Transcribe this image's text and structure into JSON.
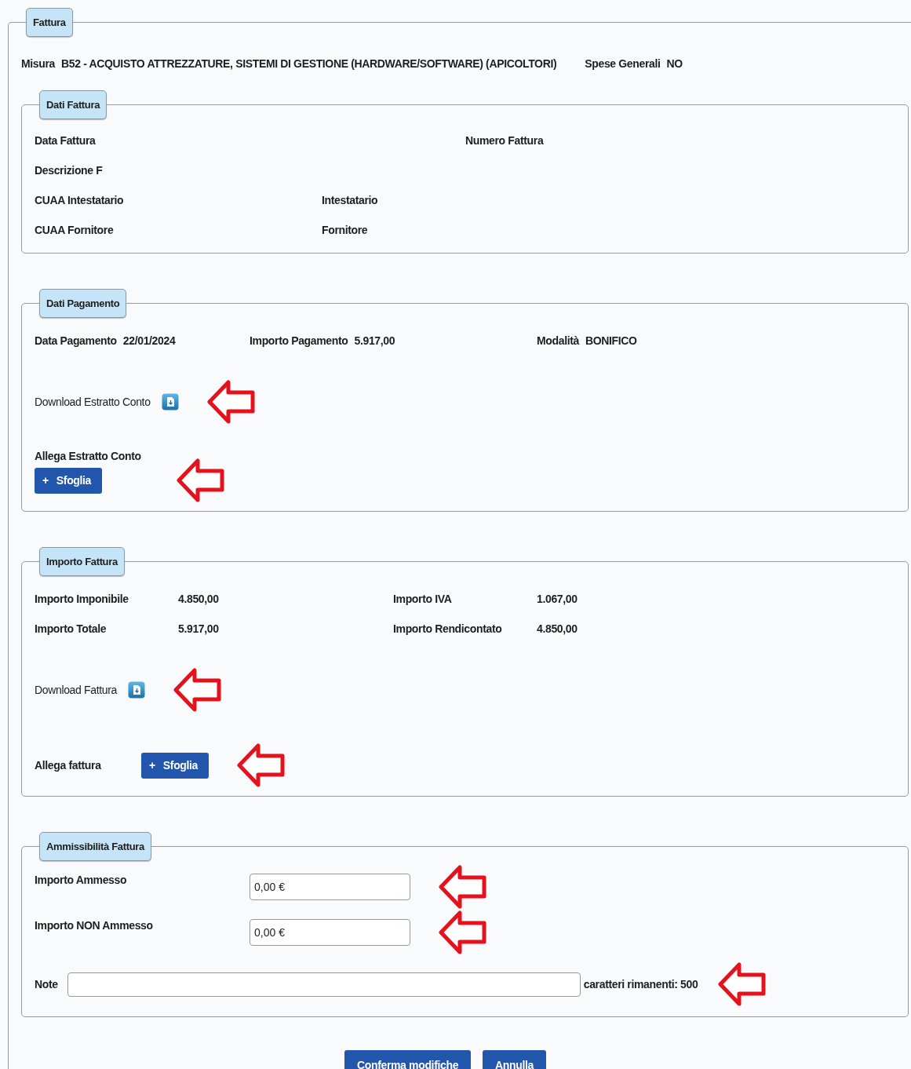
{
  "form": {
    "legend": "Fattura",
    "header": [
      {
        "label": "Misura",
        "value": "B52 - ACQUISTO ATTREZZATURE, SISTEMI DI GESTIONE (HARDWARE/SOFTWARE) (APICOLTORI)"
      },
      {
        "label": "Spese Generali",
        "value": "NO"
      }
    ],
    "sections": [
      {
        "legend": "Dati Fattura",
        "rows": [
          {
            "kind": "fields",
            "fields": [
              {
                "label": "Data Fattura"
              },
              {
                "label": "Numero Fattura"
              }
            ]
          },
          {
            "kind": "fields",
            "fields": [
              {
                "label": "Descrizione F"
              }
            ]
          },
          {
            "kind": "fields",
            "fields": [
              {
                "label": "CUAA Intestatario"
              },
              {
                "label": "Intestatario"
              }
            ]
          },
          {
            "kind": "fields",
            "fields": [
              {
                "label": "CUAA Fornitore"
              },
              {
                "label": "Fornitore"
              }
            ]
          }
        ]
      },
      {
        "legend": "Dati Pagamento",
        "rows": [
          {
            "kind": "fields",
            "fields": [
              {
                "label": "Data Pagamento",
                "value": "22/01/2024"
              },
              {
                "label": "Importo Pagamento",
                "value": "5.917,00"
              },
              {
                "label": "Modalità",
                "value": "BONIFICO"
              }
            ]
          },
          {
            "kind": "download",
            "label": "Download Estratto Conto",
            "annotated": true
          },
          {
            "kind": "upload_stacked",
            "label": "Allega Estratto Conto",
            "button_icon": "+",
            "button": "Sfoglia",
            "annotated": true
          }
        ]
      },
      {
        "legend": "Importo Fattura",
        "rows": [
          {
            "kind": "grid",
            "fields": [
              {
                "label": "Importo Imponibile",
                "value": "4.850,00"
              },
              {
                "label": "Importo IVA",
                "value": "1.067,00"
              }
            ]
          },
          {
            "kind": "grid",
            "fields": [
              {
                "label": "Importo Totale",
                "value": "5.917,00"
              },
              {
                "label": "Importo Rendicontato",
                "value": "4.850,00"
              }
            ]
          },
          {
            "kind": "download",
            "label": "Download Fattura",
            "annotated": true
          },
          {
            "kind": "upload_inline",
            "label": "Allega fattura",
            "button_icon": "+",
            "button": "Sfoglia",
            "annotated": true
          }
        ]
      },
      {
        "legend": "Ammissibilità Fattura",
        "rows": [
          {
            "kind": "input",
            "label": "Importo Ammesso",
            "value": "0,00 €",
            "annotated": true
          },
          {
            "kind": "input",
            "label": "Importo NON Ammesso",
            "value": "0,00 €",
            "annotated": true
          },
          {
            "kind": "note",
            "label": "Note",
            "counter": "caratteri rimanenti: 500",
            "annotated": true
          }
        ]
      }
    ]
  },
  "buttons": [
    {
      "label": "Conferma modifiche"
    },
    {
      "label": "Annulla"
    }
  ]
}
